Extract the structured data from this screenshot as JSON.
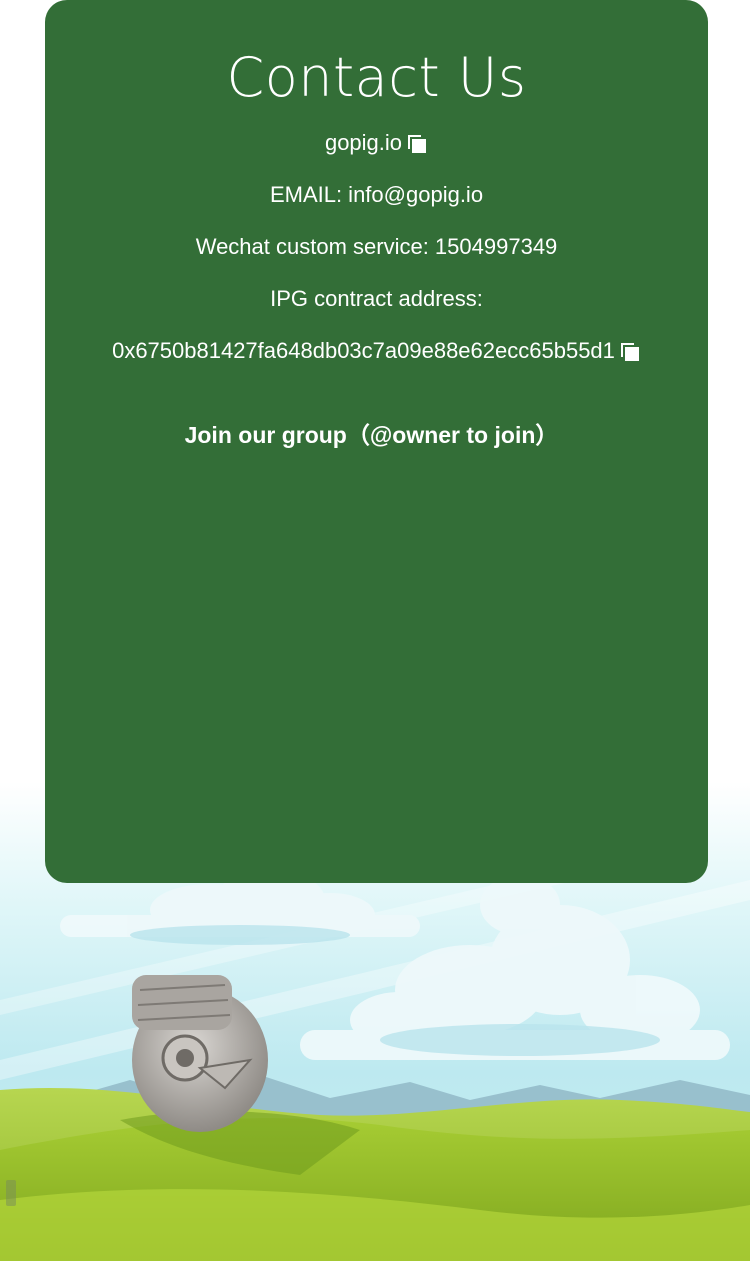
{
  "contact": {
    "title": "Contact Us",
    "website": "gopig.io",
    "email": "EMAIL:  info@gopig.io",
    "wechat": "Wechat custom service:  1504997349",
    "contract_label": "IPG contract address:",
    "contract_address": "0x6750b81427fa648db03c7a09e88e62ecc65b55d1",
    "join_group": "Join our group（@owner to join）"
  },
  "icons": {
    "copy_website": "copy-icon",
    "copy_contract": "copy-icon"
  },
  "colors": {
    "card": "#336e37",
    "text": "#ffffff",
    "sky": "#c9eef4",
    "grass": "#9bc42a"
  }
}
